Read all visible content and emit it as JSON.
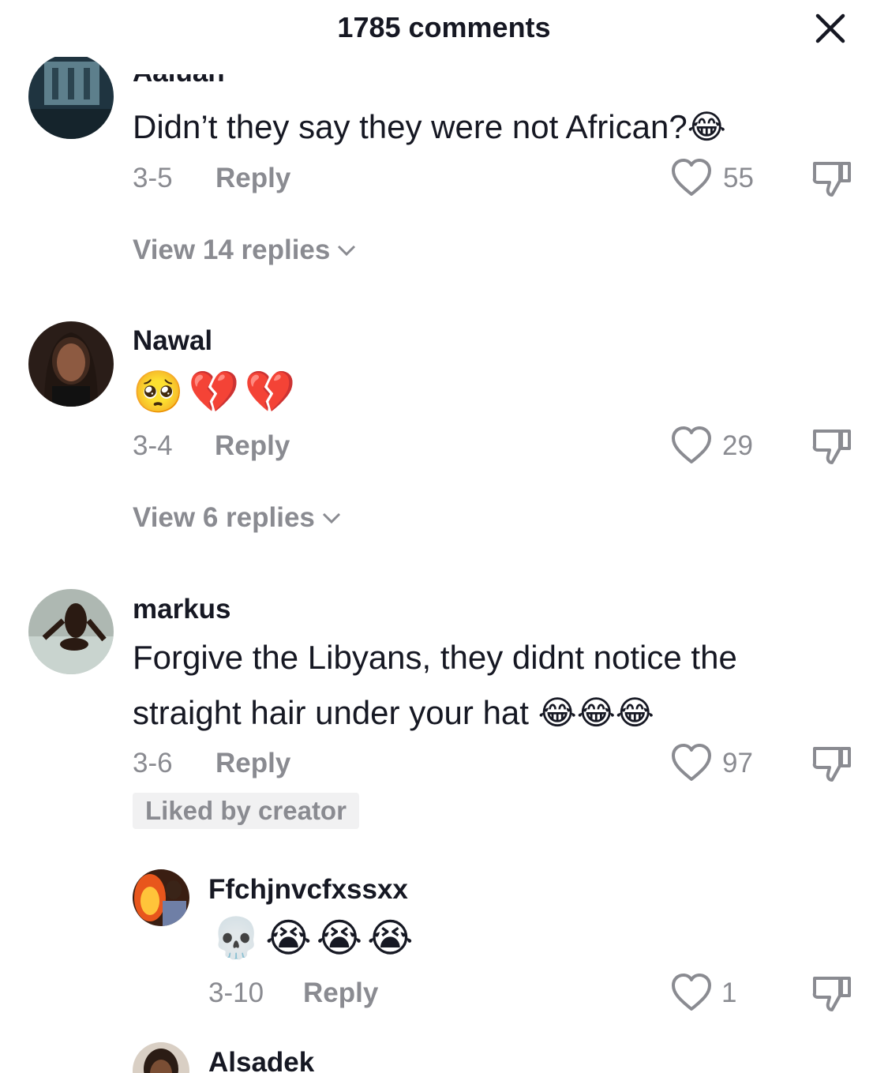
{
  "header": {
    "title": "1785 comments",
    "close_icon": "close-icon"
  },
  "comments": [
    {
      "username": "Aaluan",
      "text": "Didn’t they say they were not African?",
      "emojis": [
        "😂"
      ],
      "date": "3-5",
      "reply_label": "Reply",
      "likes": "55",
      "view_replies": "View 14 replies"
    },
    {
      "username": "Nawal",
      "emojis": [
        "🥺",
        "💔",
        "💔"
      ],
      "date": "3-4",
      "reply_label": "Reply",
      "likes": "29",
      "view_replies": "View 6 replies"
    },
    {
      "username": "markus",
      "text_line1": "Forgive the Libyans, they didnt notice the",
      "text_line2": "straight hair under your hat",
      "emojis": [
        "😂",
        "😂",
        "😂"
      ],
      "date": "3-6",
      "reply_label": "Reply",
      "likes": "97",
      "badge": "Liked by creator"
    },
    {
      "username": "Ffchjnvcfxssxx",
      "emojis": [
        "💀",
        "😭",
        "😭",
        "😭"
      ],
      "date": "3-10",
      "reply_label": "Reply",
      "likes": "1"
    },
    {
      "username": "Alsadek"
    }
  ]
}
